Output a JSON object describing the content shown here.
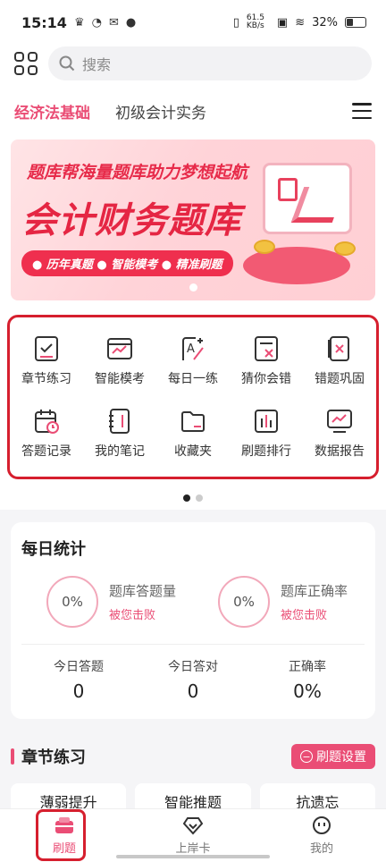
{
  "status": {
    "time": "15:14",
    "net_speed": "61.5 KB/s",
    "battery": "32%"
  },
  "search": {
    "placeholder": "搜索"
  },
  "tabs": [
    {
      "label": "经济法基础",
      "active": true
    },
    {
      "label": "初级会计实务",
      "active": false
    }
  ],
  "banner": {
    "subtitle": "题库帮海量题库助力梦想起航",
    "title": "会计财务题库",
    "tags": "● 历年真题   ● 智能模考   ● 精准刷题"
  },
  "features": [
    {
      "label": "章节练习",
      "icon": "chapter-practice-icon"
    },
    {
      "label": "智能模考",
      "icon": "smart-exam-icon"
    },
    {
      "label": "每日一练",
      "icon": "daily-practice-icon"
    },
    {
      "label": "猜你会错",
      "icon": "guess-wrong-icon"
    },
    {
      "label": "错题巩固",
      "icon": "wrong-review-icon"
    },
    {
      "label": "答题记录",
      "icon": "answer-record-icon"
    },
    {
      "label": "我的笔记",
      "icon": "notes-icon"
    },
    {
      "label": "收藏夹",
      "icon": "folder-icon"
    },
    {
      "label": "刷题排行",
      "icon": "ranking-icon"
    },
    {
      "label": "数据报告",
      "icon": "report-icon"
    }
  ],
  "daily_stats": {
    "title": "每日统计",
    "rings": [
      {
        "value": "0%",
        "label": "题库答题量",
        "sub": "被您击败"
      },
      {
        "value": "0%",
        "label": "题库正确率",
        "sub": "被您击败"
      }
    ],
    "totals": [
      {
        "label": "今日答题",
        "value": "0"
      },
      {
        "label": "今日答对",
        "value": "0"
      },
      {
        "label": "正确率",
        "value": "0%"
      }
    ]
  },
  "chapter": {
    "title": "章节练习",
    "settings_label": "刷题设置",
    "chips": [
      "薄弱提升",
      "智能推题",
      "抗遗忘"
    ]
  },
  "nav": [
    {
      "label": "刷题",
      "icon": "practice-icon",
      "active": true
    },
    {
      "label": "上岸卡",
      "icon": "diamond-icon",
      "active": false
    },
    {
      "label": "我的",
      "icon": "profile-icon",
      "active": false
    }
  ],
  "colors": {
    "accent": "#ea4d75",
    "highlight_border": "#d61f2e"
  }
}
